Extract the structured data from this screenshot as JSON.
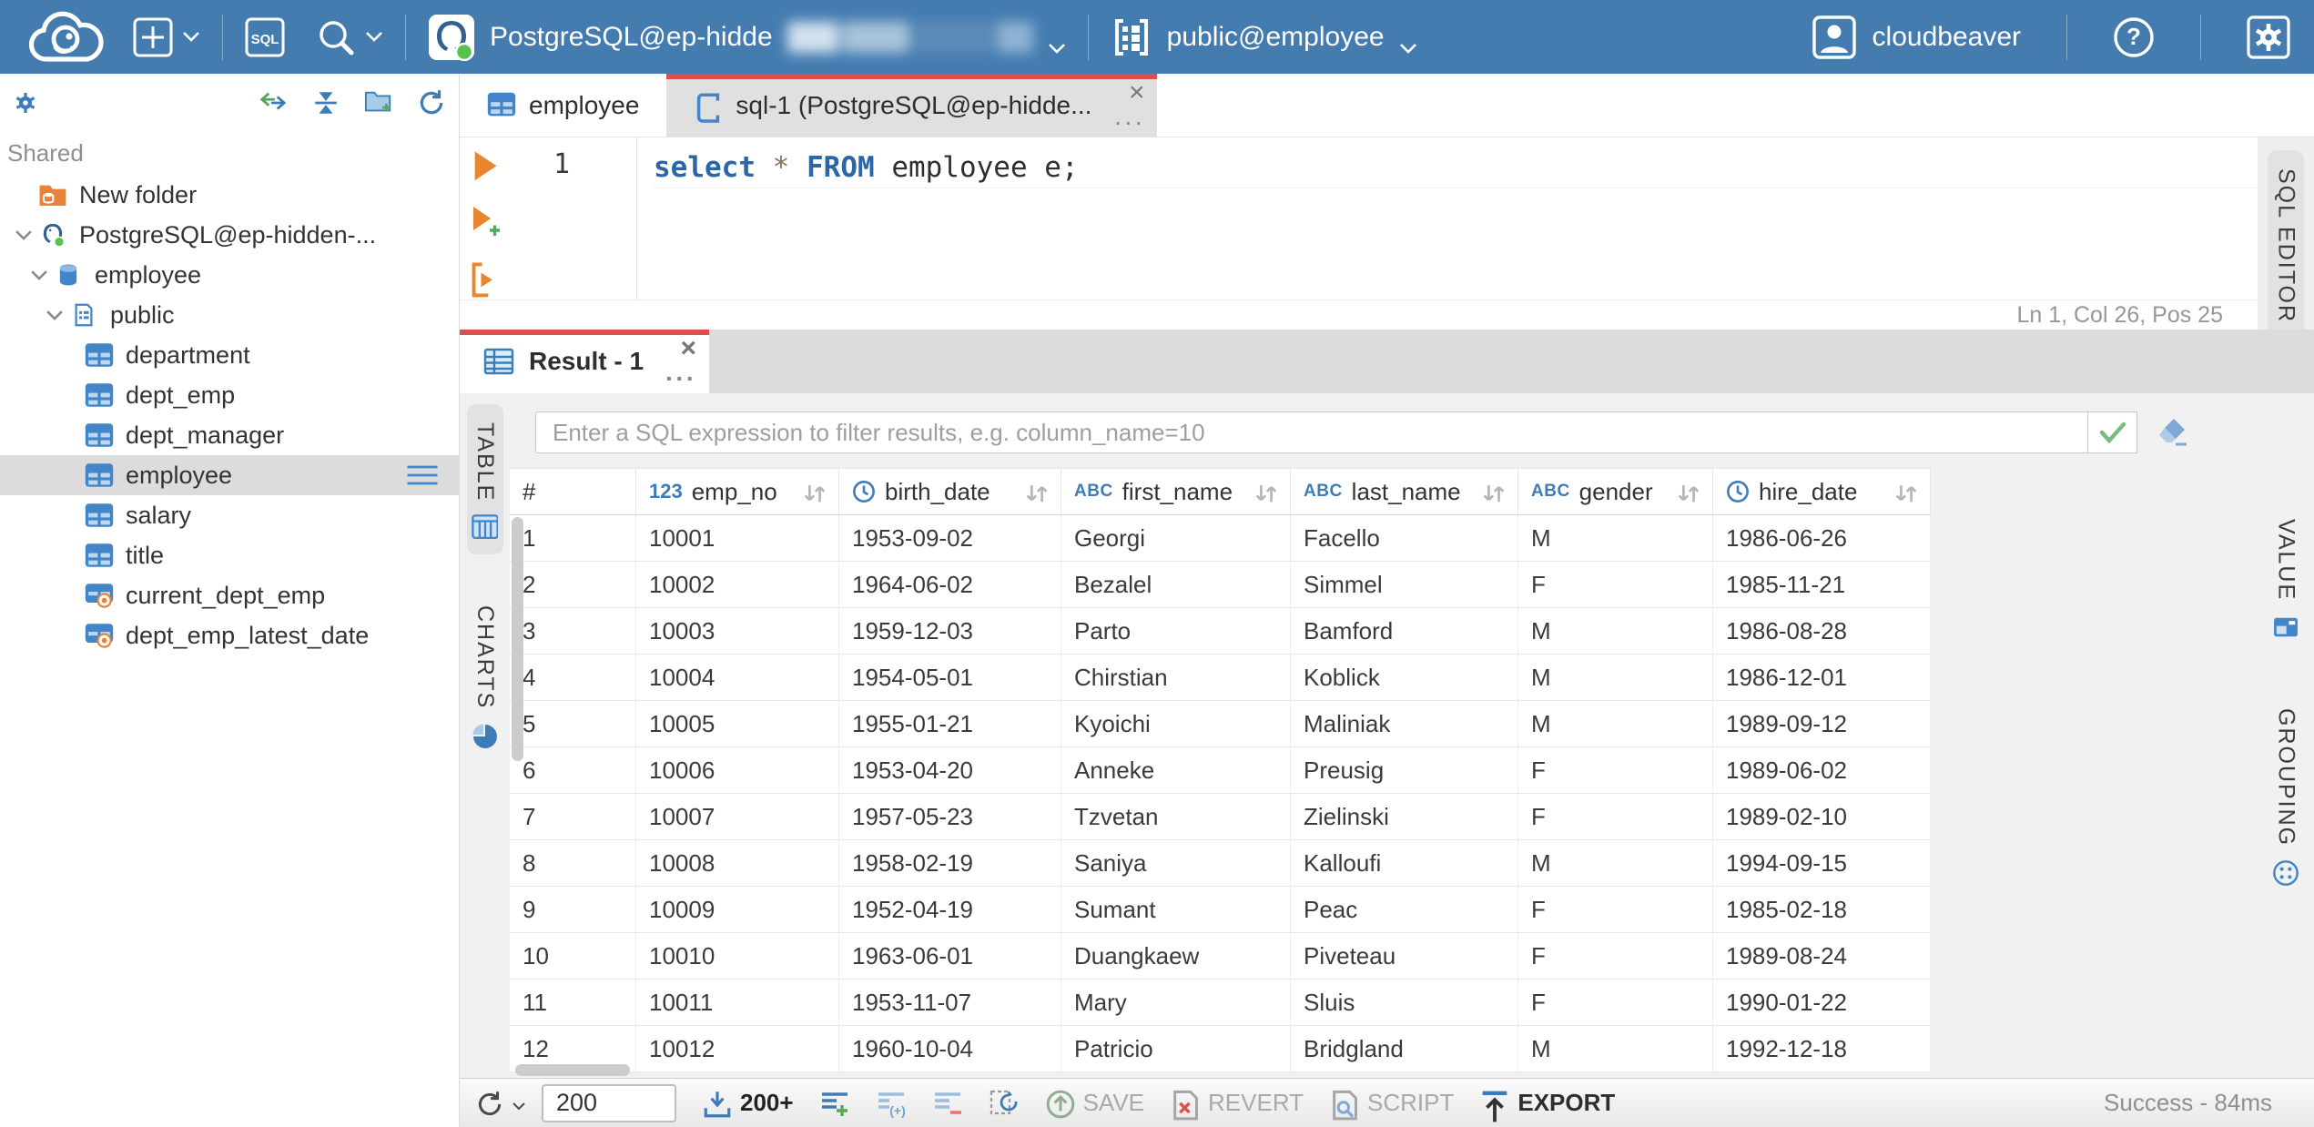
{
  "topbar": {
    "sql_editor_button": "SQL",
    "connection_label": "PostgreSQL@ep-hidde",
    "schema_selector": "public@employee",
    "username": "cloudbeaver"
  },
  "sidebar": {
    "section_label": "Shared",
    "tree": [
      {
        "label": "New folder",
        "icon": "folderdb",
        "level": 0,
        "expander": false,
        "selected": false
      },
      {
        "label": "PostgreSQL@ep-hidden-...",
        "icon": "postgres",
        "level": 0,
        "expander": true,
        "selected": false
      },
      {
        "label": "employee",
        "icon": "database",
        "level": 1,
        "expander": true,
        "selected": false
      },
      {
        "label": "public",
        "icon": "schema",
        "level": 2,
        "expander": true,
        "selected": false
      },
      {
        "label": "department",
        "icon": "table",
        "level": 3,
        "expander": false,
        "selected": false
      },
      {
        "label": "dept_emp",
        "icon": "table",
        "level": 3,
        "expander": false,
        "selected": false
      },
      {
        "label": "dept_manager",
        "icon": "table",
        "level": 3,
        "expander": false,
        "selected": false
      },
      {
        "label": "employee",
        "icon": "table",
        "level": 3,
        "expander": false,
        "selected": true
      },
      {
        "label": "salary",
        "icon": "table",
        "level": 3,
        "expander": false,
        "selected": false
      },
      {
        "label": "title",
        "icon": "table",
        "level": 3,
        "expander": false,
        "selected": false
      },
      {
        "label": "current_dept_emp",
        "icon": "view",
        "level": 3,
        "expander": false,
        "selected": false
      },
      {
        "label": "dept_emp_latest_date",
        "icon": "view",
        "level": 3,
        "expander": false,
        "selected": false
      }
    ]
  },
  "editor": {
    "tabs": [
      {
        "label": "employee",
        "icon": "table",
        "active": false
      },
      {
        "label": "sql-1 (PostgreSQL@ep-hidde...",
        "icon": "script",
        "active": true
      }
    ],
    "line_number": "1",
    "code": [
      {
        "text": "select",
        "type": "keyword"
      },
      {
        "text": " ",
        "type": "plain"
      },
      {
        "text": "*",
        "type": "star"
      },
      {
        "text": " ",
        "type": "plain"
      },
      {
        "text": "FROM",
        "type": "keyword"
      },
      {
        "text": " employee e;",
        "type": "plain"
      }
    ],
    "status": "Ln 1, Col 26, Pos 25"
  },
  "result": {
    "tab_label": "Result - 1",
    "filter_placeholder": "Enter a SQL expression to filter results, e.g. column_name=10",
    "left_tabs": [
      {
        "label": "TABLE",
        "icon": "grid",
        "active": true
      },
      {
        "label": "CHARTS",
        "icon": "pie",
        "active": false
      }
    ],
    "editor_side_tab": {
      "label": "SQL EDITOR",
      "icon": "script",
      "active": true
    },
    "result_side_tabs": [
      {
        "label": "VALUE",
        "icon": "value",
        "active": false
      },
      {
        "label": "GROUPING",
        "icon": "grouping",
        "active": false
      }
    ],
    "grid": {
      "columns": [
        {
          "name": "#",
          "type": "rownum"
        },
        {
          "name": "emp_no",
          "type": "number"
        },
        {
          "name": "birth_date",
          "type": "date"
        },
        {
          "name": "first_name",
          "type": "string"
        },
        {
          "name": "last_name",
          "type": "string"
        },
        {
          "name": "gender",
          "type": "string"
        },
        {
          "name": "hire_date",
          "type": "date"
        }
      ],
      "rows": [
        [
          "1",
          "10001",
          "1953-09-02",
          "Georgi",
          "Facello",
          "M",
          "1986-06-26"
        ],
        [
          "2",
          "10002",
          "1964-06-02",
          "Bezalel",
          "Simmel",
          "F",
          "1985-11-21"
        ],
        [
          "3",
          "10003",
          "1959-12-03",
          "Parto",
          "Bamford",
          "M",
          "1986-08-28"
        ],
        [
          "4",
          "10004",
          "1954-05-01",
          "Chirstian",
          "Koblick",
          "M",
          "1986-12-01"
        ],
        [
          "5",
          "10005",
          "1955-01-21",
          "Kyoichi",
          "Maliniak",
          "M",
          "1989-09-12"
        ],
        [
          "6",
          "10006",
          "1953-04-20",
          "Anneke",
          "Preusig",
          "F",
          "1989-06-02"
        ],
        [
          "7",
          "10007",
          "1957-05-23",
          "Tzvetan",
          "Zielinski",
          "F",
          "1989-02-10"
        ],
        [
          "8",
          "10008",
          "1958-02-19",
          "Saniya",
          "Kalloufi",
          "M",
          "1994-09-15"
        ],
        [
          "9",
          "10009",
          "1952-04-19",
          "Sumant",
          "Peac",
          "F",
          "1985-02-18"
        ],
        [
          "10",
          "10010",
          "1963-06-01",
          "Duangkaew",
          "Piveteau",
          "F",
          "1989-08-24"
        ],
        [
          "11",
          "10011",
          "1953-11-07",
          "Mary",
          "Sluis",
          "F",
          "1990-01-22"
        ],
        [
          "12",
          "10012",
          "1960-10-04",
          "Patricio",
          "Bridgland",
          "M",
          "1992-12-18"
        ]
      ]
    },
    "toolbar": {
      "row_limit": "200",
      "fetch_more": "200+",
      "save": "SAVE",
      "revert": "REVERT",
      "script": "SCRIPT",
      "export": "EXPORT",
      "status": "Success - 84ms"
    }
  },
  "colors": {
    "topbar_blue": "#447cb0",
    "accent_red": "#d9504e",
    "icon_blue": "#3e7cb8",
    "selection_grey": "#dcdcdc"
  }
}
